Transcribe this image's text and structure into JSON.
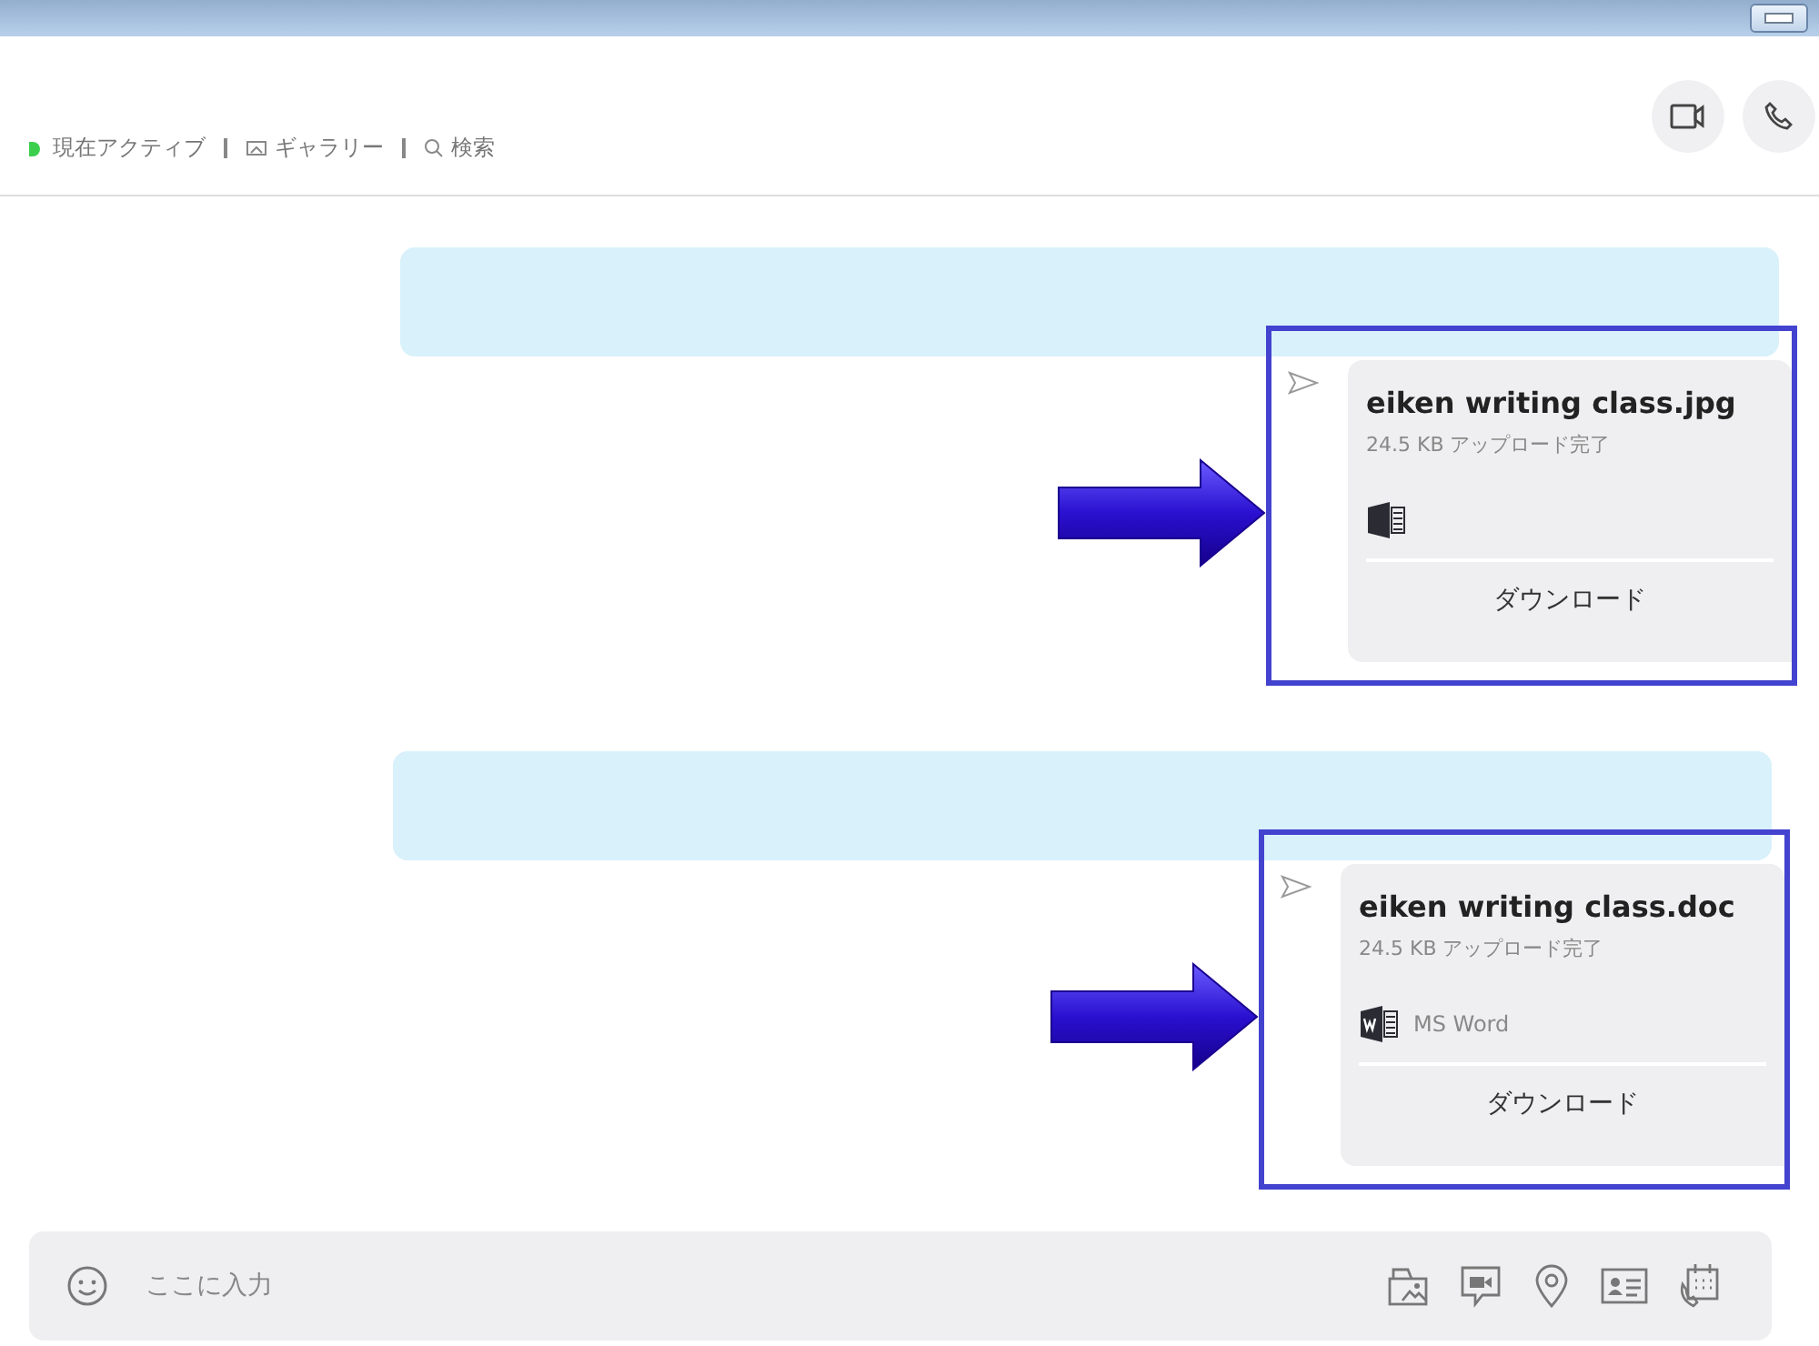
{
  "header": {
    "status": "現在アクティブ",
    "active": true,
    "links": [
      {
        "kind": "gallery",
        "label": "ギャラリー"
      },
      {
        "kind": "search",
        "label": "検索"
      }
    ]
  },
  "messages": [
    {
      "highlighted": true,
      "file": {
        "name": "eiken writing class.jpg",
        "meta": "24.5 KB アップロード完了",
        "kind": "generic",
        "download": "ダウンロード"
      }
    },
    {
      "highlighted": true,
      "file": {
        "name": "eiken writing class.doc",
        "meta": "24.5 KB アップロード完了",
        "kind": "word",
        "type_label": "MS Word",
        "download": "ダウンロード"
      }
    }
  ],
  "composer": {
    "placeholder": "ここに入力"
  }
}
